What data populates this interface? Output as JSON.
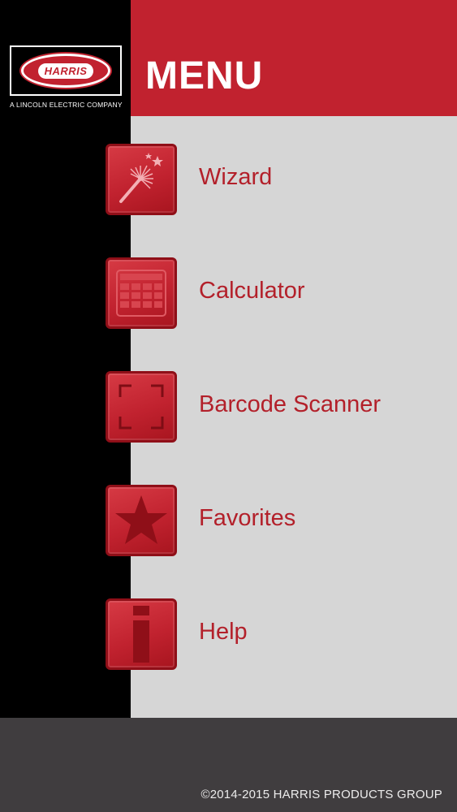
{
  "header": {
    "title": "MENU"
  },
  "logo": {
    "brand": "HARRIS",
    "tagline": "A LINCOLN ELECTRIC COMPANY"
  },
  "menu": {
    "items": [
      {
        "label": "Wizard",
        "icon": "magic-wand-icon"
      },
      {
        "label": "Calculator",
        "icon": "calculator-icon"
      },
      {
        "label": "Barcode Scanner",
        "icon": "barcode-frame-icon"
      },
      {
        "label": "Favorites",
        "icon": "star-icon"
      },
      {
        "label": "Help",
        "icon": "info-icon"
      }
    ]
  },
  "footer": {
    "copyright": "©2014-2015 HARRIS PRODUCTS GROUP"
  },
  "colors": {
    "brand_red": "#c1222f",
    "sidebar": "#000000",
    "background": "#d6d6d6",
    "footer": "#403d3f",
    "label_red": "#b3202a"
  }
}
